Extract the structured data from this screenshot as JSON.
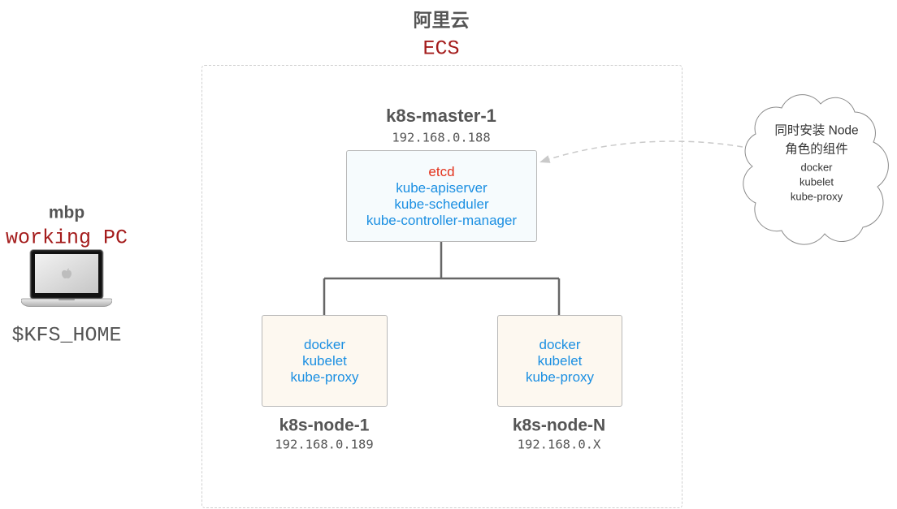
{
  "provider": {
    "name": "阿里云",
    "service": "ECS"
  },
  "master": {
    "name": "k8s-master-1",
    "ip": "192.168.0.188",
    "components": [
      {
        "label": "etcd",
        "color": "#e3321c"
      },
      {
        "label": "kube-apiserver",
        "color": "#1b8fe2"
      },
      {
        "label": "kube-scheduler",
        "color": "#1b8fe2"
      },
      {
        "label": "kube-controller-manager",
        "color": "#1b8fe2"
      }
    ]
  },
  "nodes": [
    {
      "name": "k8s-node-1",
      "ip": "192.168.0.189",
      "components": [
        "docker",
        "kubelet",
        "kube-proxy"
      ]
    },
    {
      "name": "k8s-node-N",
      "ip": "192.168.0.X",
      "components": [
        "docker",
        "kubelet",
        "kube-proxy"
      ]
    }
  ],
  "workstation": {
    "name": "mbp",
    "role": "working PC",
    "path": "$KFS_HOME",
    "icon": "laptop-icon"
  },
  "note": {
    "lines": [
      "同时安装 Node",
      "角色的组件"
    ],
    "components": [
      "docker",
      "kubelet",
      "kube-proxy"
    ],
    "icon": "cloud-shape"
  },
  "colors": {
    "heading": "#555555",
    "accent_red": "#a41c1c",
    "component_blue": "#1b8fe2",
    "etcd_red": "#e3321c",
    "master_box_fill": "#f6fbfd",
    "node_box_fill": "#fdf8f0",
    "connector": "#666666",
    "boundary": "#cfcfcf",
    "note_text": "#333333"
  }
}
